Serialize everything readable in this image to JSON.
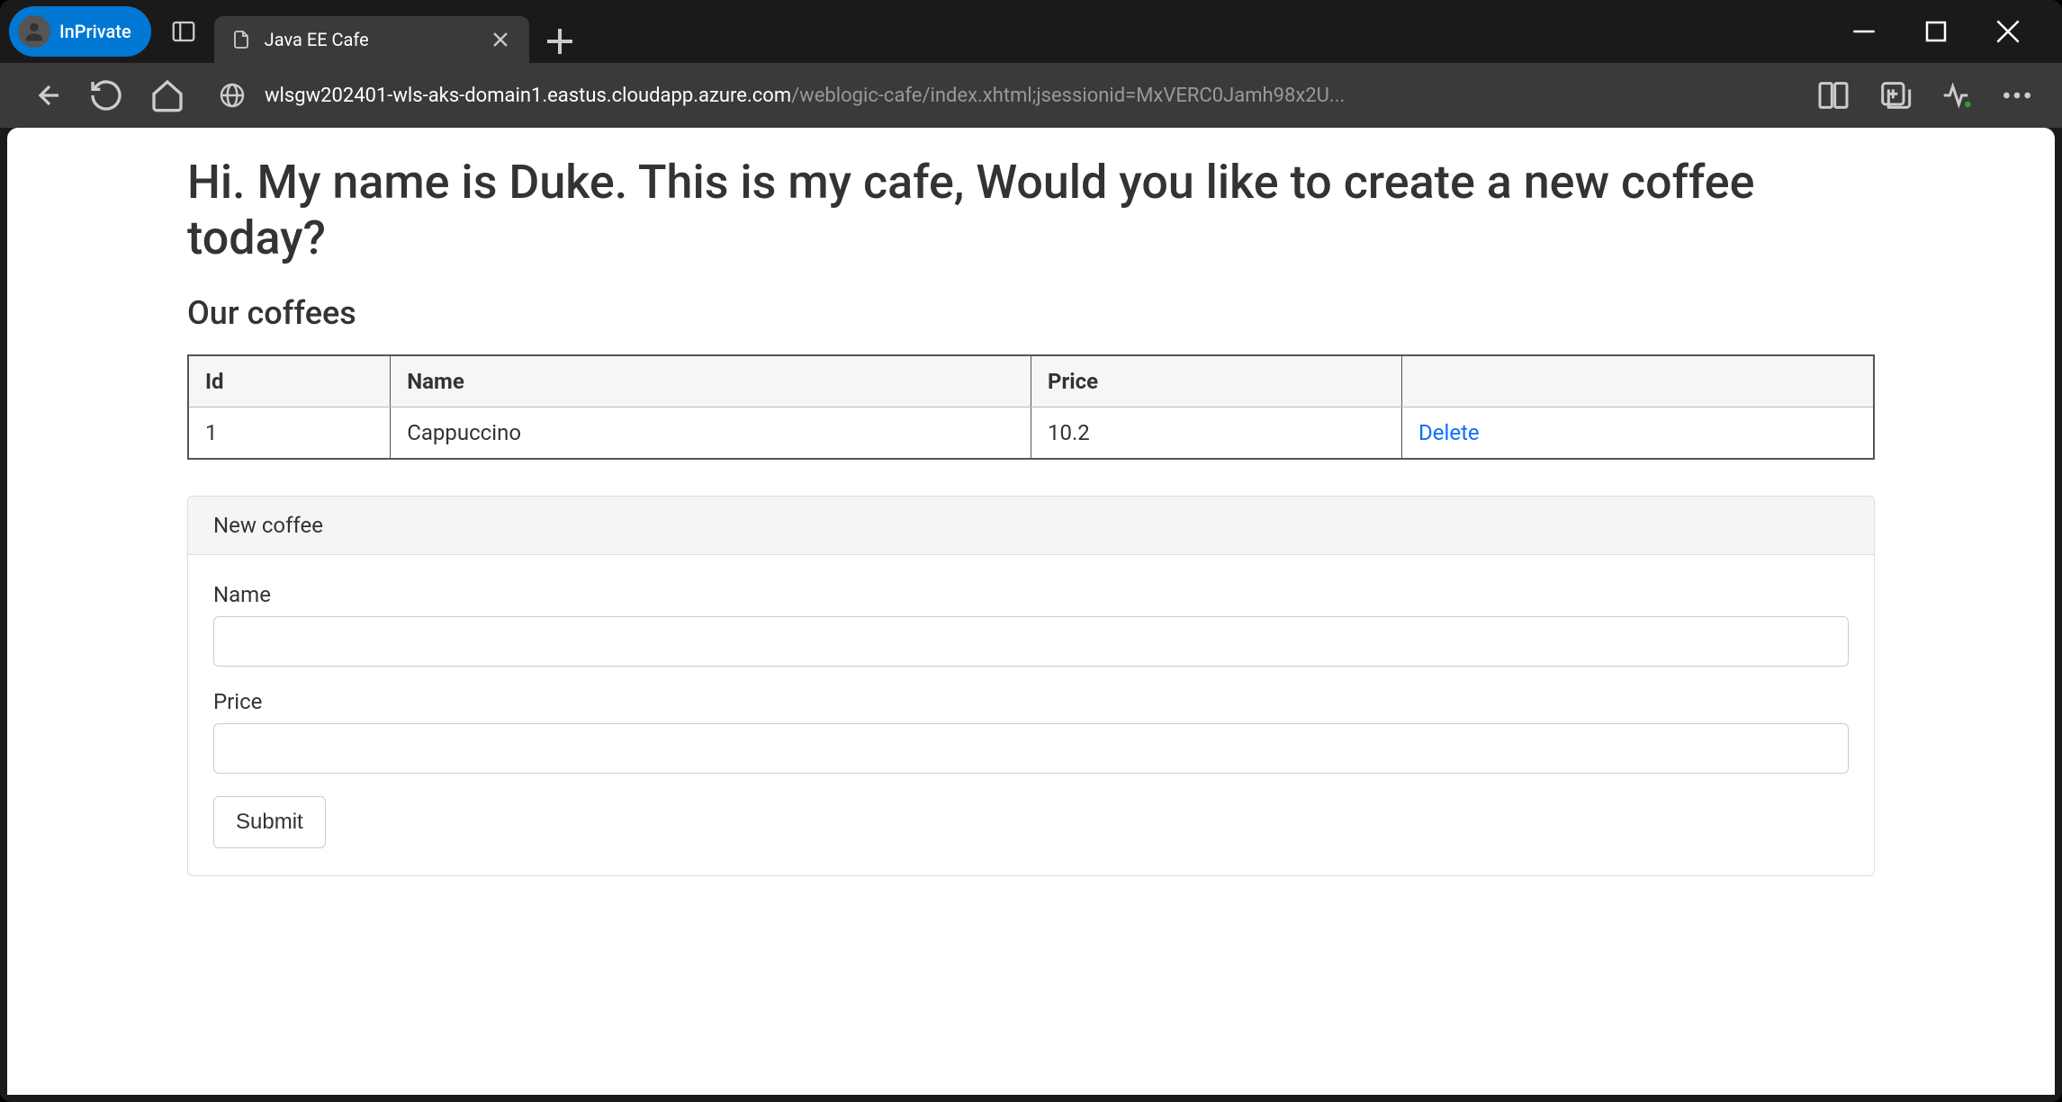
{
  "browser": {
    "inprivate_label": "InPrivate",
    "tab_title": "Java EE Cafe",
    "url_host": "wlsgw202401-wls-aks-domain1.eastus.cloudapp.azure.com",
    "url_path": "/weblogic-cafe/index.xhtml;jsessionid=MxVERC0Jamh98x2U..."
  },
  "page": {
    "heading": "Hi. My name is Duke. This is my cafe, Would you like to create a new coffee today?",
    "subheading": "Our coffees",
    "table": {
      "headers": {
        "id": "Id",
        "name": "Name",
        "price": "Price",
        "actions": ""
      },
      "rows": [
        {
          "id": "1",
          "name": "Cappuccino",
          "price": "10.2",
          "action_label": "Delete"
        }
      ]
    },
    "form": {
      "panel_title": "New coffee",
      "name_label": "Name",
      "name_value": "",
      "price_label": "Price",
      "price_value": "",
      "submit_label": "Submit"
    }
  }
}
